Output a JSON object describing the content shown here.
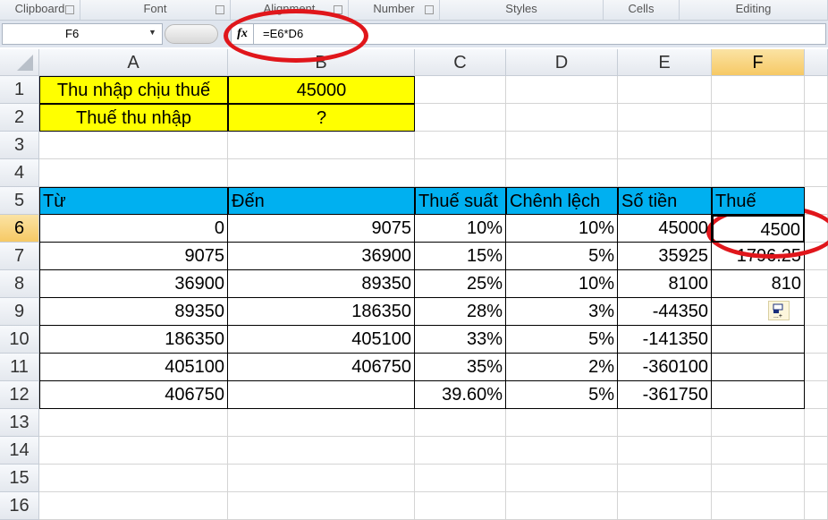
{
  "ribbon": {
    "groups": [
      "Clipboard",
      "Font",
      "Alignment",
      "Number",
      "Styles",
      "Cells",
      "Editing"
    ]
  },
  "formula_bar": {
    "name_box": "F6",
    "fx_icon": "fx-icon",
    "formula": "=E6*D6"
  },
  "columns": [
    "A",
    "B",
    "C",
    "D",
    "E",
    "F"
  ],
  "rows": [
    "1",
    "2",
    "3",
    "4",
    "5",
    "6",
    "7",
    "8",
    "9",
    "10",
    "11",
    "12",
    "13",
    "14",
    "15",
    "16"
  ],
  "selected_cell": "F6",
  "colors": {
    "yellow": "#ffff00",
    "header_blue": "#00b0f0",
    "annotation": "#e0161b"
  },
  "cells": {
    "A1": "Thu nhập chịu thuế",
    "B1": "45000",
    "A2": "Thuế thu nhập",
    "B2": "?",
    "A5": "Từ",
    "B5": "Đến",
    "C5": "Thuế suất",
    "D5": "Chênh lệch",
    "E5": "Số tiền",
    "F5": "Thuế",
    "A6": "0",
    "B6": "9075",
    "C6": "10%",
    "D6": "10%",
    "E6": "45000",
    "F6": "4500",
    "A7": "9075",
    "B7": "36900",
    "C7": "15%",
    "D7": "5%",
    "E7": "35925",
    "F7": "1796.25",
    "A8": "36900",
    "B8": "89350",
    "C8": "25%",
    "D8": "10%",
    "E8": "8100",
    "F8": "810",
    "A9": "89350",
    "B9": "186350",
    "C9": "28%",
    "D9": "3%",
    "E9": "-44350",
    "A10": "186350",
    "B10": "405100",
    "C10": "33%",
    "D10": "5%",
    "E10": "-141350",
    "A11": "405100",
    "B11": "406750",
    "C11": "35%",
    "D11": "2%",
    "E11": "-360100",
    "A12": "406750",
    "C12": "39.60%",
    "D12": "5%",
    "E12": "-361750"
  }
}
